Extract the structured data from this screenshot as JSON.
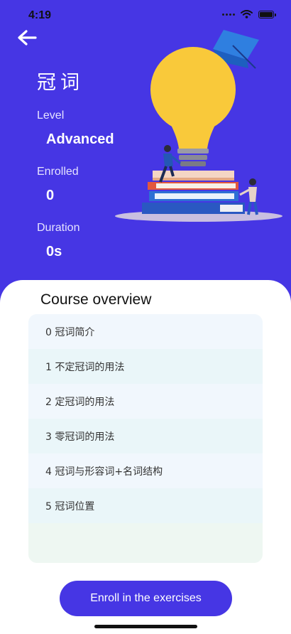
{
  "status_bar": {
    "time": "4:19"
  },
  "course": {
    "title": "冠词",
    "level_label": "Level",
    "level_value": "Advanced",
    "enrolled_label": "Enrolled",
    "enrolled_value": "0",
    "duration_label": "Duration",
    "duration_value": "0s"
  },
  "overview": {
    "title": "Course overview",
    "lessons": [
      {
        "label": "0 冠词简介"
      },
      {
        "label": "1 不定冠词的用法"
      },
      {
        "label": "2 定冠词的用法"
      },
      {
        "label": "3 零冠词的用法"
      },
      {
        "label": "4 冠词与形容词+名词结构"
      },
      {
        "label": "5 冠词位置"
      }
    ]
  },
  "enroll_button": {
    "label": "Enroll in the exercises"
  },
  "colors": {
    "brand": "#4636e4",
    "bulb": "#f9c93a",
    "row_light_blue": "#f1f7fd",
    "row_light_cyan": "#eaf6f9"
  },
  "icons": [
    "back-arrow-icon",
    "wifi-icon",
    "battery-icon",
    "cellular-dots-icon",
    "lightbulb-illustration"
  ]
}
